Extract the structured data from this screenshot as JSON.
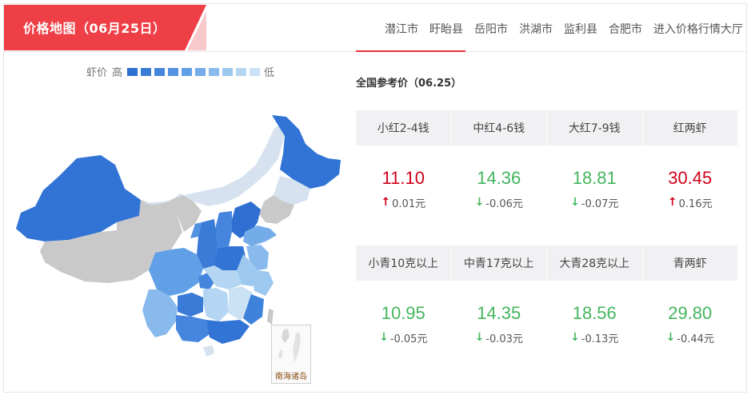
{
  "header": {
    "title": "价格地图（06月25日）",
    "cities": [
      "潜江市",
      "盱眙县",
      "岳阳市",
      "洪湖市",
      "监利县",
      "合肥市",
      "进入价格行情大厅"
    ]
  },
  "legend": {
    "prefix": "虾价",
    "high": "高",
    "low": "低",
    "colors": [
      "#2f6fd2",
      "#3a7bd8",
      "#4585de",
      "#5292e2",
      "#619fe6",
      "#74acea",
      "#88baed",
      "#9dc8f0",
      "#b4d6f3",
      "#cbe1f4"
    ]
  },
  "map": {
    "inset_label": "南海诸岛"
  },
  "prices": {
    "title": "全国参考价（06.25）",
    "row1": [
      {
        "name": "小红2-4钱",
        "value": "11.10",
        "change": "0.01元",
        "dir": "up"
      },
      {
        "name": "中红4-6钱",
        "value": "14.36",
        "change": "-0.06元",
        "dir": "down"
      },
      {
        "name": "大红7-9钱",
        "value": "18.81",
        "change": "-0.07元",
        "dir": "down"
      },
      {
        "name": "红两虾",
        "value": "30.45",
        "change": "0.16元",
        "dir": "up"
      }
    ],
    "row2": [
      {
        "name": "小青10克以上",
        "value": "10.95",
        "change": "-0.05元",
        "dir": "down"
      },
      {
        "name": "中青17克以上",
        "value": "14.35",
        "change": "-0.03元",
        "dir": "down"
      },
      {
        "name": "大青28克以上",
        "value": "18.56",
        "change": "-0.13元",
        "dir": "down"
      },
      {
        "name": "青两虾",
        "value": "29.80",
        "change": "-0.44元",
        "dir": "down"
      }
    ]
  }
}
